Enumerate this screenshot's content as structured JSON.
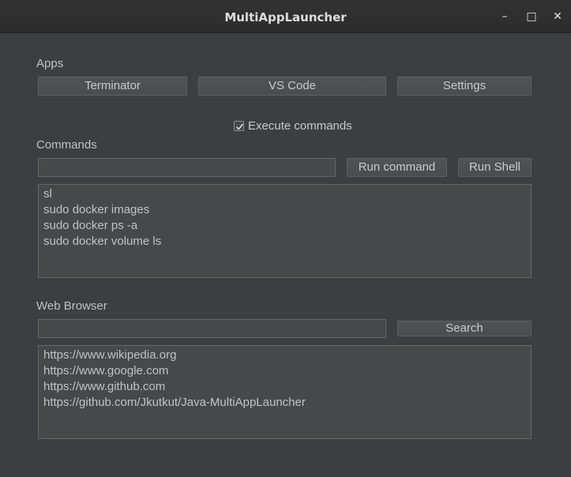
{
  "window": {
    "title": "MultiAppLauncher",
    "minimize_glyph": "–",
    "maximize_glyph": "□",
    "close_glyph": "✕"
  },
  "apps": {
    "label": "Apps",
    "buttons": [
      "Terminator",
      "VS Code",
      "Settings"
    ]
  },
  "execute_commands": {
    "label": "Execute commands",
    "checked": true
  },
  "commands": {
    "label": "Commands",
    "input_value": "",
    "run_command_label": "Run command",
    "run_shell_label": "Run Shell",
    "items": [
      "sl",
      "sudo docker images",
      "sudo docker ps -a",
      "sudo docker volume ls"
    ]
  },
  "web_browser": {
    "label": "Web Browser",
    "input_value": "",
    "search_label": "Search",
    "items": [
      "https://www.wikipedia.org",
      "https://www.google.com",
      "https://www.github.com",
      "https://github.com/Jkutkut/Java-MultiAppLauncher"
    ]
  },
  "colors": {
    "background": "#3c3f41",
    "control": "#4a4d4f",
    "text": "#c8cbcd"
  }
}
